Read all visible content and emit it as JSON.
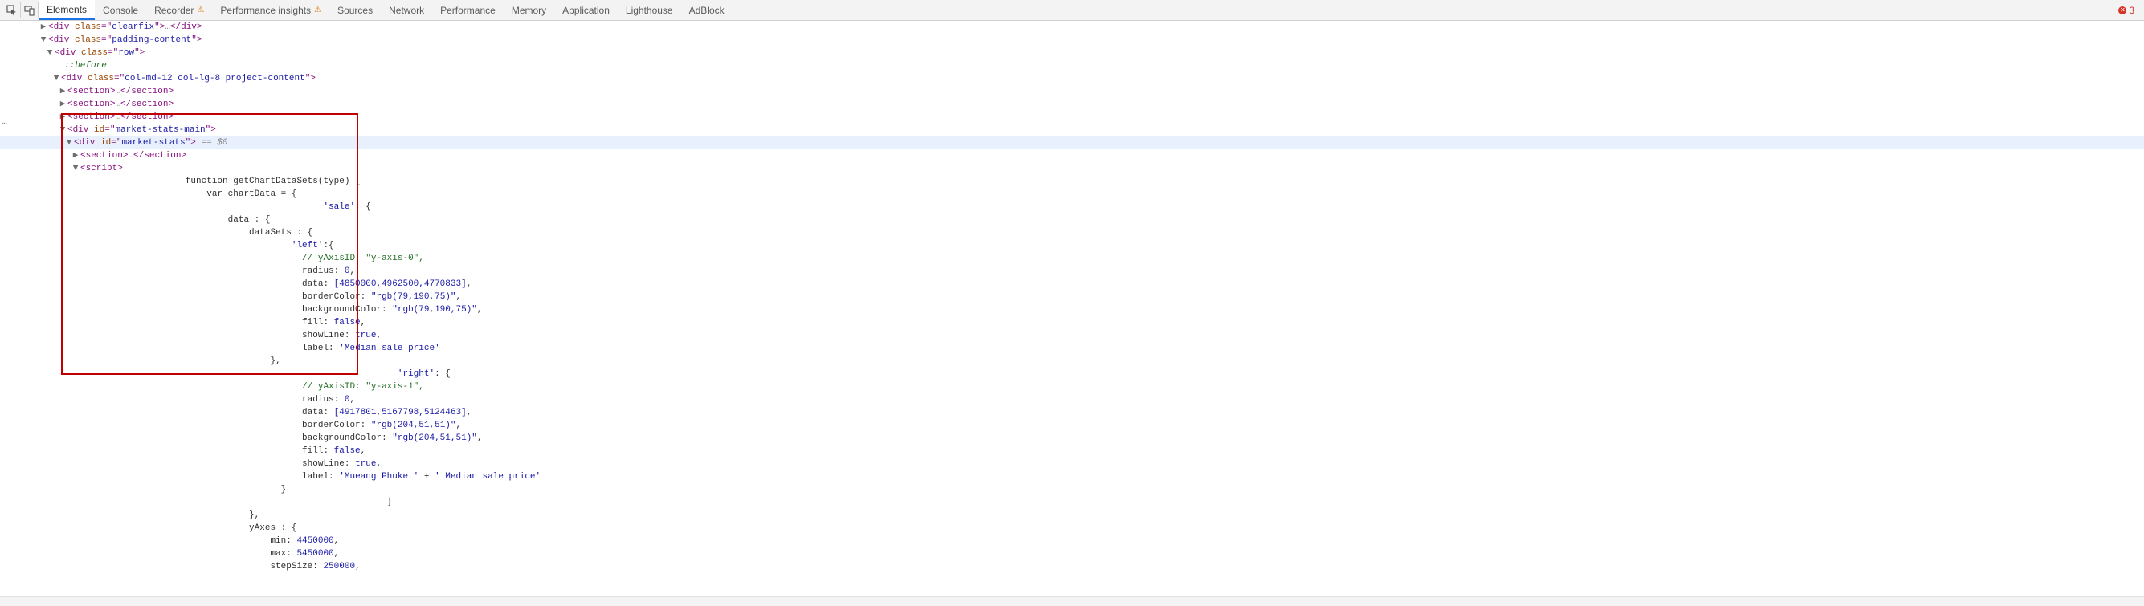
{
  "toolbar": {
    "tabs": [
      "Elements",
      "Console",
      "Recorder",
      "Performance insights",
      "Sources",
      "Network",
      "Performance",
      "Memory",
      "Application",
      "Lighthouse",
      "AdBlock"
    ],
    "active_tab_index": 0,
    "warn_tab_indices": [
      2,
      3
    ],
    "error_count": "3"
  },
  "dom_tree": {
    "l1": {
      "html": "<div class=\"clearfix\">…</div>"
    },
    "l2": {
      "html": "<div class=\"padding-content\">"
    },
    "l3": {
      "html": "<div class=\"row\">"
    },
    "l4": {
      "text": "::before"
    },
    "l5": {
      "html": "<div class=\"col-md-12 col-lg-8 project-content\">"
    },
    "l6": {
      "html": "<section>…</section>"
    },
    "l7": {
      "html": "<section>…</section>"
    },
    "l8": {
      "html": "<section>…</section>"
    },
    "l9": {
      "html": "<div id=\"market-stats-main\">"
    },
    "l10": {
      "html": "<div id=\"market-stats\">",
      "marker": " == $0"
    },
    "l11": {
      "html": "<section>…</section>"
    },
    "l12": {
      "html": "<script>"
    }
  },
  "script_lines": [
    {
      "indent": 18,
      "type": "plain",
      "text": "function getChartDataSets(type) {"
    },
    {
      "indent": 22,
      "type": "plain",
      "text": "var chartData = {"
    },
    {
      "indent": 44,
      "type": "str",
      "text": "'sale': {"
    },
    {
      "indent": 26,
      "type": "plain",
      "text": "data : {"
    },
    {
      "indent": 30,
      "type": "plain",
      "text": "dataSets : {"
    },
    {
      "indent": 38,
      "type": "str",
      "text": "'left':{"
    },
    {
      "indent": 40,
      "type": "comment",
      "text": "// yAxisID: \"y-axis-0\","
    },
    {
      "indent": 40,
      "type": "kv",
      "key": "radius",
      "val": "0",
      "trail": ","
    },
    {
      "indent": 40,
      "type": "kv",
      "key": "data",
      "val": "[4850000,4962500,4770833]",
      "trail": ","
    },
    {
      "indent": 40,
      "type": "kv",
      "key": "borderColor",
      "sval": "\"rgb(79,190,75)\"",
      "trail": ","
    },
    {
      "indent": 40,
      "type": "kv",
      "key": "backgroundColor",
      "sval": "\"rgb(79,190,75)\"",
      "trail": ","
    },
    {
      "indent": 40,
      "type": "kv",
      "key": "fill",
      "val": "false",
      "trail": ","
    },
    {
      "indent": 40,
      "type": "kv",
      "key": "showLine",
      "val": "true",
      "trail": ","
    },
    {
      "indent": 40,
      "type": "kv",
      "key": "label",
      "sval": "'Median sale price'",
      "trail": ""
    },
    {
      "indent": 34,
      "type": "plain",
      "text": "},"
    },
    {
      "indent": 58,
      "type": "str",
      "text": "'right': {"
    },
    {
      "indent": 40,
      "type": "comment",
      "text": "// yAxisID: \"y-axis-1\","
    },
    {
      "indent": 40,
      "type": "kv",
      "key": "radius",
      "val": "0",
      "trail": ","
    },
    {
      "indent": 40,
      "type": "kv",
      "key": "data",
      "val": "[4917801,5167798,5124463]",
      "trail": ","
    },
    {
      "indent": 40,
      "type": "kv",
      "key": "borderColor",
      "sval": "\"rgb(204,51,51)\"",
      "trail": ","
    },
    {
      "indent": 40,
      "type": "kv",
      "key": "backgroundColor",
      "sval": "\"rgb(204,51,51)\"",
      "trail": ","
    },
    {
      "indent": 40,
      "type": "kv",
      "key": "fill",
      "val": "false",
      "trail": ","
    },
    {
      "indent": 40,
      "type": "kv",
      "key": "showLine",
      "val": "true",
      "trail": ","
    },
    {
      "indent": 40,
      "type": "kvconcat",
      "key": "label",
      "part1": "'Mueang Phuket'",
      "mid": " + ",
      "part2": "' Median sale price'",
      "trail": ""
    },
    {
      "indent": 36,
      "type": "plain",
      "text": "}"
    },
    {
      "indent": 56,
      "type": "plain",
      "text": "}"
    },
    {
      "indent": 30,
      "type": "plain",
      "text": "},"
    },
    {
      "indent": 30,
      "type": "plain",
      "text": "yAxes : {"
    },
    {
      "indent": 34,
      "type": "kv",
      "key": "min",
      "val": "4450000",
      "trail": ","
    },
    {
      "indent": 34,
      "type": "kv",
      "key": "max",
      "val": "5450000",
      "trail": ","
    },
    {
      "indent": 34,
      "type": "kv",
      "key": "stepSize",
      "val": "250000",
      "trail": ","
    }
  ]
}
